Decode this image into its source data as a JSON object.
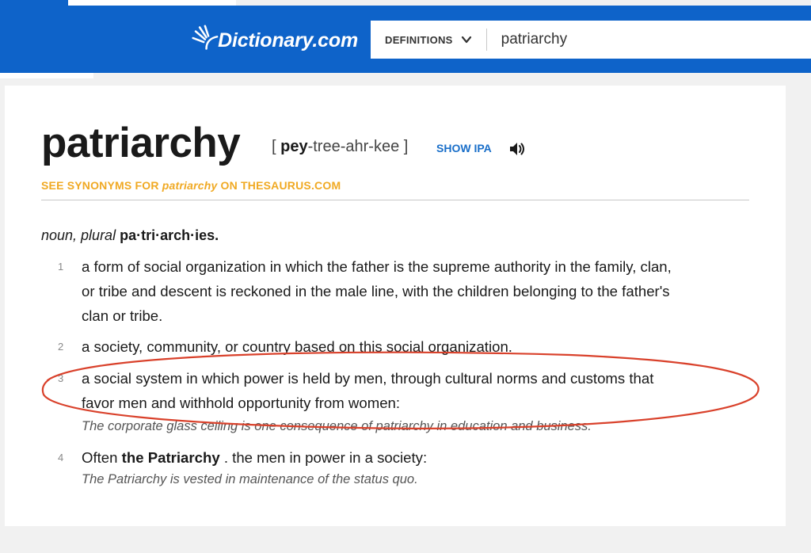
{
  "header": {
    "logo_text": "Dictionary.com",
    "brand_color": "#0e63c9",
    "dropdown_label": "DEFINITIONS",
    "search_value": "patriarchy"
  },
  "entry": {
    "headword": "patriarchy",
    "pron_open": "[ ",
    "pron_stress": "pey",
    "pron_rest": "-tree-ahr-kee ]",
    "show_ipa": "SHOW IPA",
    "synonyms_prefix": "SEE SYNONYMS FOR ",
    "synonyms_word": "patriarchy",
    "synonyms_suffix": " ON THESAURUS.COM",
    "pos_label": "noun, plural",
    "plural_form": "pa·tri·arch·ies.",
    "senses": [
      {
        "num": "1",
        "lines": [
          "a form of social organization in which the father is the supreme authority in the family, clan,",
          "or tribe and descent is reckoned in the male line, with the children belonging to the father's",
          "clan or tribe."
        ]
      },
      {
        "num": "2",
        "lines": [
          "a society, community, or country based on this social organization."
        ]
      },
      {
        "num": "3",
        "lines": [
          "a social system in which power is held by men, through cultural norms and customs that",
          "favor men and withhold opportunity from women:"
        ],
        "example": "The corporate glass ceiling is one consequence of patriarchy in education and business."
      },
      {
        "num": "4",
        "prefix": "Often ",
        "bold": "the Patriarchy",
        "suffix": " . the men in power in a society:",
        "example": "The Patriarchy is vested in maintenance of the status quo."
      }
    ]
  },
  "annotation": {
    "color": "#d9412b"
  },
  "icons": {
    "logo": "sunburst-logo-icon",
    "dropdown": "chevron-down-icon",
    "audio": "speaker-icon"
  }
}
